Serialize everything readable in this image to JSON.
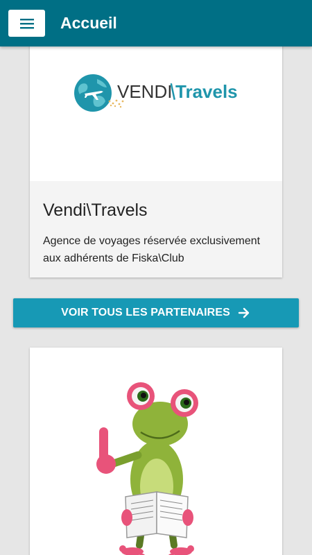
{
  "appbar": {
    "title": "Accueil",
    "menu_icon": "hamburger-menu-icon"
  },
  "colors": {
    "appbar": "#006f85",
    "cta": "#1799b5",
    "background": "#e6e6e6"
  },
  "partner_card": {
    "logo_text_left": "VENDI",
    "logo_text_right": "Travels",
    "title": "Vendi\\Travels",
    "description": "Agence de voyages réservée exclusivement aux adhérents de Fiska\\Club"
  },
  "cta": {
    "label": "VOIR TOUS LES PARTENAIRES",
    "icon": "arrow-right-icon"
  },
  "second_card": {
    "image": "frog-reading-book-illustration"
  }
}
